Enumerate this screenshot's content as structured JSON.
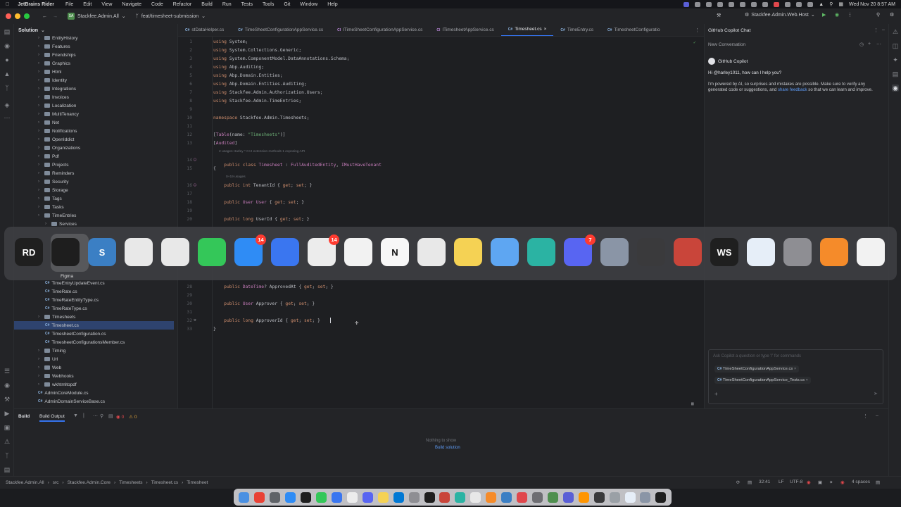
{
  "menubar": {
    "app": "JetBrains Rider",
    "items": [
      "File",
      "Edit",
      "View",
      "Navigate",
      "Code",
      "Refactor",
      "Build",
      "Run",
      "Tests",
      "Tools",
      "Git",
      "Window",
      "Help"
    ],
    "datetime": "Wed Nov 20  8:57 AM"
  },
  "titlebar": {
    "project": "Stackfee.Admin.All",
    "branch": "feat/timesheet-submission",
    "run_config": "Stackfee.Admin.Web.Host"
  },
  "solution": {
    "title": "Solution",
    "rows": [
      {
        "label": "EntityHistory",
        "type": "folder",
        "depth": 1
      },
      {
        "label": "Features",
        "type": "folder",
        "depth": 1
      },
      {
        "label": "Friendships",
        "type": "folder",
        "depth": 1
      },
      {
        "label": "Graphics",
        "type": "folder",
        "depth": 1
      },
      {
        "label": "Html",
        "type": "folder",
        "depth": 1
      },
      {
        "label": "Identity",
        "type": "folder",
        "depth": 1
      },
      {
        "label": "Integrations",
        "type": "folder",
        "depth": 1
      },
      {
        "label": "Invoices",
        "type": "folder",
        "depth": 1
      },
      {
        "label": "Localization",
        "type": "folder",
        "depth": 1
      },
      {
        "label": "MultiTenancy",
        "type": "folder",
        "depth": 1
      },
      {
        "label": "Net",
        "type": "folder",
        "depth": 1
      },
      {
        "label": "Notifications",
        "type": "folder",
        "depth": 1
      },
      {
        "label": "OpenIddict",
        "type": "folder",
        "depth": 1
      },
      {
        "label": "Organizations",
        "type": "folder",
        "depth": 1
      },
      {
        "label": "Pdf",
        "type": "folder",
        "depth": 1
      },
      {
        "label": "Projects",
        "type": "folder",
        "depth": 1
      },
      {
        "label": "Reminders",
        "type": "folder",
        "depth": 1
      },
      {
        "label": "Security",
        "type": "folder",
        "depth": 1
      },
      {
        "label": "Storage",
        "type": "folder",
        "depth": 1
      },
      {
        "label": "Tags",
        "type": "folder",
        "depth": 1
      },
      {
        "label": "Tasks",
        "type": "folder",
        "depth": 1
      },
      {
        "label": "TimeEntries",
        "type": "folder",
        "depth": 1
      },
      {
        "label": "Services",
        "type": "folder",
        "depth": 2
      }
    ],
    "rows_lower": [
      {
        "label": "TimeEntryUpdateEvent.cs",
        "type": "file",
        "depth": 2
      },
      {
        "label": "TimeRate.cs",
        "type": "file",
        "depth": 2
      },
      {
        "label": "TimeRateEntityType.cs",
        "type": "file",
        "depth": 2
      },
      {
        "label": "TimeRateType.cs",
        "type": "file",
        "depth": 2
      },
      {
        "label": "Timesheets",
        "type": "folder",
        "depth": 1
      },
      {
        "label": "Timesheet.cs",
        "type": "file",
        "depth": 2,
        "selected": true
      },
      {
        "label": "TimesheetConfiguration.cs",
        "type": "file",
        "depth": 2
      },
      {
        "label": "TimesheetConfigurationsMember.cs",
        "type": "file",
        "depth": 2
      },
      {
        "label": "Timing",
        "type": "folder",
        "depth": 1
      },
      {
        "label": "Url",
        "type": "folder",
        "depth": 1
      },
      {
        "label": "Web",
        "type": "folder",
        "depth": 1
      },
      {
        "label": "Webhooks",
        "type": "folder",
        "depth": 1
      },
      {
        "label": "wkhtmltopdf",
        "type": "folder",
        "depth": 1
      },
      {
        "label": "AdminCoreModule.cs",
        "type": "file",
        "depth": 1
      },
      {
        "label": "AdminDomainServiceBase.cs",
        "type": "file",
        "depth": 1
      }
    ]
  },
  "tabs": [
    {
      "label": "stDataHelper.cs",
      "kind": "cs"
    },
    {
      "label": "TimeSheetConfigurationAppService.cs",
      "kind": "cs"
    },
    {
      "label": "ITimeSheetConfigurationAppService.cs",
      "kind": "ci"
    },
    {
      "label": "ITimesheetAppService.cs",
      "kind": "ci"
    },
    {
      "label": "Timesheet.cs",
      "kind": "cs",
      "active": true
    },
    {
      "label": "TimeEntry.cs",
      "kind": "cs"
    },
    {
      "label": "TimesheetConfiguratio",
      "kind": "cs"
    }
  ],
  "code": {
    "lines_top": [
      {
        "n": "1",
        "t": "using System;"
      },
      {
        "n": "2",
        "t": "using System.Collections.Generic;"
      },
      {
        "n": "3",
        "t": "using System.ComponentModel.DataAnnotations.Schema;"
      },
      {
        "n": "4",
        "t": "using Abp.Auditing;"
      },
      {
        "n": "5",
        "t": "using Abp.Domain.Entities;"
      },
      {
        "n": "6",
        "t": "using Abp.Domain.Entities.Auditing;"
      },
      {
        "n": "7",
        "t": "using Stackfee.Admin.Authorization.Users;"
      },
      {
        "n": "8",
        "t": "using Stackfee.Admin.TimeEntries;"
      },
      {
        "n": "9",
        "t": ""
      },
      {
        "n": "10",
        "t": "namespace Stackfee.Admin.Timesheets;"
      },
      {
        "n": "11",
        "t": ""
      },
      {
        "n": "12",
        "t": "[Table(name: \"Timesheets\")]"
      },
      {
        "n": "13",
        "t": "[Audited]"
      }
    ],
    "hint_class": "2 usages   Harley *   0+2 extension methods   1 exposing API",
    "line14": "public class Timesheet : FullAuditedEntity, IMustHaveTenant",
    "line15": "{",
    "hint_usages": "0+19 usages",
    "lines_mid": [
      {
        "n": "16",
        "t": "    public int TenantId { get; set; }"
      },
      {
        "n": "17",
        "t": ""
      },
      {
        "n": "18",
        "t": "    public User User { get; set; }"
      },
      {
        "n": "19",
        "t": ""
      },
      {
        "n": "20",
        "t": "    public long UserId { get; set; }"
      }
    ],
    "lines_bottom": [
      {
        "n": "28",
        "t": "    public DateTime? ApprovedAt { get; set; }"
      },
      {
        "n": "29",
        "t": ""
      },
      {
        "n": "30",
        "t": "    public User Approver { get; set; }"
      },
      {
        "n": "31",
        "t": ""
      },
      {
        "n": "32",
        "t": "    public long ApproverId { get; set; }"
      },
      {
        "n": "33",
        "t": "}"
      }
    ]
  },
  "copilot": {
    "title": "GitHub Copilot Chat",
    "new_conversation": "New Conversation",
    "bot_name": "GitHub Copilot",
    "greeting": "Hi @harley1011, how can I help you?",
    "disclaimer_1": "I'm powered by AI, so surprises and mistakes are possible. Make sure to verify any generated code or suggestions, and ",
    "disclaimer_link": "share feedback",
    "disclaimer_2": " so that we can learn and improve.",
    "input_placeholder": "Ask Copilot a question or type '/' for commands",
    "attachments": [
      "TimeSheetConfigurationAppService.cs",
      "TimeSheetConfigurationAppService_Tests.cs"
    ]
  },
  "build": {
    "tab_build": "Build",
    "tab_output": "Build Output",
    "errors": "0",
    "warnings": "0",
    "empty": "Nothing to show",
    "link": "Build solution"
  },
  "status": {
    "breadcrumb": [
      "Stackfee.Admin.All",
      "src",
      "Stackfee.Admin.Core",
      "Timesheets",
      "Timesheet.cs",
      "Timesheet"
    ],
    "position": "32:41",
    "line_sep": "LF",
    "encoding": "UTF-8",
    "indent": "4 spaces"
  },
  "switcher": {
    "selected_label": "Figma",
    "apps": [
      {
        "name": "rider-icon",
        "text": "RD",
        "color": "#1f1f1f",
        "badge": ""
      },
      {
        "name": "figma-icon",
        "text": "",
        "color": "#1e1e1e",
        "badge": ""
      },
      {
        "name": "scrivener-icon",
        "text": "S",
        "color": "#3b7fc4",
        "badge": ""
      },
      {
        "name": "chatgpt-icon",
        "text": "",
        "color": "#e8e8e8",
        "badge": ""
      },
      {
        "name": "chrome-icon",
        "text": "",
        "color": "#e8e8e8",
        "badge": ""
      },
      {
        "name": "messages-icon",
        "text": "",
        "color": "#34c759",
        "badge": ""
      },
      {
        "name": "mail-icon",
        "text": "",
        "color": "#2f8cf5",
        "badge": "14"
      },
      {
        "name": "signal-icon",
        "text": "",
        "color": "#3a76f0",
        "badge": ""
      },
      {
        "name": "slack-icon",
        "text": "",
        "color": "#ececec",
        "badge": "14"
      },
      {
        "name": "photos-icon",
        "text": "",
        "color": "#f2f2f2",
        "badge": ""
      },
      {
        "name": "notion-icon",
        "text": "N",
        "color": "#f7f7f7",
        "badge": ""
      },
      {
        "name": "cloudapp-icon",
        "text": "",
        "color": "#e8e8e8",
        "badge": ""
      },
      {
        "name": "notes-icon",
        "text": "",
        "color": "#f5d254",
        "badge": ""
      },
      {
        "name": "finder-icon",
        "text": "",
        "color": "#5ea6f2",
        "badge": ""
      },
      {
        "name": "surfshark-icon",
        "text": "",
        "color": "#2bb3a3",
        "badge": ""
      },
      {
        "name": "discord-icon",
        "text": "",
        "color": "#5865f2",
        "badge": "7"
      },
      {
        "name": "screen-icon",
        "text": "",
        "color": "#8a95a6",
        "badge": ""
      },
      {
        "name": "calculator-icon",
        "text": "",
        "color": "#3a3a3c",
        "badge": ""
      },
      {
        "name": "remote-desktop-icon",
        "text": "",
        "color": "#c9453a",
        "badge": ""
      },
      {
        "name": "webstorm-icon",
        "text": "WS",
        "color": "#1f1f1f",
        "badge": ""
      },
      {
        "name": "excalidraw-icon",
        "text": "",
        "color": "#e6eef8",
        "badge": ""
      },
      {
        "name": "settings-icon",
        "text": "",
        "color": "#8e8e93",
        "badge": ""
      },
      {
        "name": "pen-icon",
        "text": "",
        "color": "#f58b2a",
        "badge": ""
      },
      {
        "name": "vscode-icon",
        "text": "",
        "color": "#f2f2f2",
        "badge": ""
      }
    ]
  },
  "colors": {
    "accent": "#3574f0",
    "keyword": "#cf8e6d",
    "class": "#c77dbb",
    "string": "#6aab73"
  }
}
